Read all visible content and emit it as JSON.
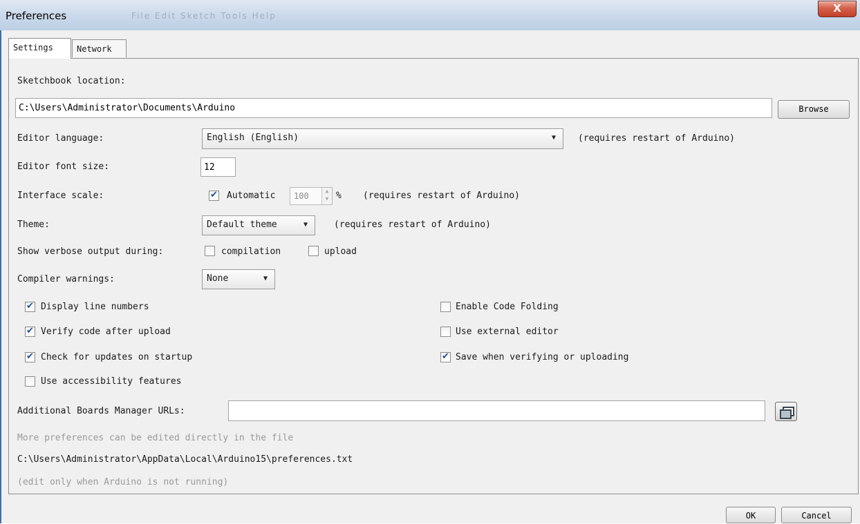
{
  "window": {
    "title": "Preferences",
    "close_label": "X"
  },
  "tabs": [
    {
      "label": "Settings"
    },
    {
      "label": "Network"
    }
  ],
  "settings": {
    "sketchbook_label": "Sketchbook location:",
    "sketchbook_value": "C:\\Users\\Administrator\\Documents\\Arduino",
    "browse_label": "Browse",
    "editor_language_label": "Editor language:",
    "editor_language_value": "English (English)",
    "restart_note": "(requires restart of Arduino)",
    "font_size_label": "Editor font size:",
    "font_size_value": "12",
    "interface_scale_label": "Interface scale:",
    "automatic_label": "Automatic",
    "scale_value": "100",
    "scale_unit": "%",
    "theme_label": "Theme:",
    "theme_value": "Default theme",
    "verbose_label": "Show verbose output during:",
    "compilation_label": "compilation",
    "upload_label": "upload",
    "compiler_warnings_label": "Compiler warnings:",
    "compiler_warnings_value": "None",
    "checkboxes_left": [
      {
        "label": "Display line numbers",
        "checked": true
      },
      {
        "label": "Verify code after upload",
        "checked": true
      },
      {
        "label": "Check for updates on startup",
        "checked": true
      },
      {
        "label": "Use accessibility features",
        "checked": false
      }
    ],
    "checkboxes_right": [
      {
        "label": "Enable Code Folding",
        "checked": false
      },
      {
        "label": "Use external editor",
        "checked": false
      },
      {
        "label": "Save when verifying or uploading",
        "checked": true
      }
    ],
    "boards_urls_label": "Additional Boards Manager URLs:",
    "boards_urls_value": "",
    "more_prefs_note": "More preferences can be edited directly in the file",
    "prefs_path": "C:\\Users\\Administrator\\AppData\\Local\\Arduino15\\preferences.txt",
    "edit_note": "(edit only when Arduino is not running)"
  },
  "footer": {
    "ok_label": "OK",
    "cancel_label": "Cancel"
  }
}
